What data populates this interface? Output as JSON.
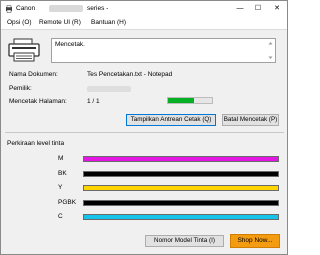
{
  "window": {
    "title_prefix": "Canon",
    "title_suffix": "series -",
    "minimize": "—",
    "maximize": "☐",
    "close": "✕"
  },
  "menu": {
    "items": [
      "Opsi (O)",
      "Remote UI (R)",
      "Bantuan (H)"
    ]
  },
  "status": {
    "message": "Mencetak."
  },
  "document": {
    "name_label": "Nama Dokumen:",
    "name_value": "Tes Pencetakan.txt - Notepad",
    "owner_label": "Pemilik:",
    "pages_label": "Mencetak Halaman:",
    "pages_value": "1 / 1",
    "progress": 0.6
  },
  "buttons": {
    "show_queue": "Tampilkan Antrean Cetak (Q)",
    "cancel_print": "Batal Mencetak (P)",
    "ink_model": "Nomor Model Tinta (I)",
    "shop": "Shop Now..."
  },
  "ink": {
    "section_title": "Perkiraan level tinta",
    "items": [
      {
        "label": "M",
        "color": "#e316e3"
      },
      {
        "label": "BK",
        "color": "#000000"
      },
      {
        "label": "Y",
        "color": "#ffd500"
      },
      {
        "label": "PGBK",
        "color": "#000000"
      },
      {
        "label": "C",
        "color": "#17c3ea"
      }
    ]
  },
  "colors": {
    "accent": "#0078d7",
    "progress": "#06b025",
    "shop": "#f39c12"
  }
}
